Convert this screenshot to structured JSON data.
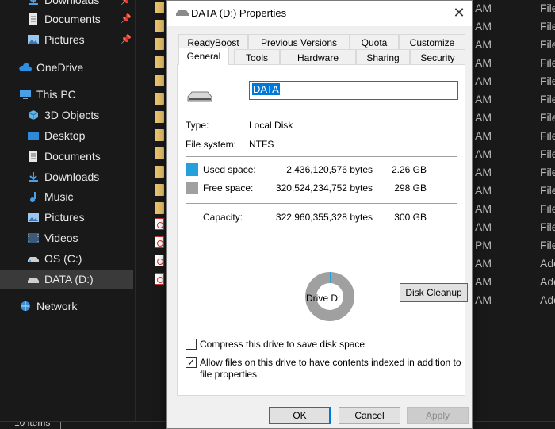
{
  "explorer": {
    "nav": [
      {
        "label": "Downloads",
        "icon": "download-arrow-icon",
        "pinned": true
      },
      {
        "label": "Documents",
        "icon": "documents-icon",
        "pinned": true
      },
      {
        "label": "Pictures",
        "icon": "pictures-icon",
        "pinned": true
      },
      {
        "label": "OneDrive",
        "icon": "cloud-icon"
      },
      {
        "label": "This PC",
        "icon": "computer-icon"
      },
      {
        "label": "3D Objects",
        "icon": "cube-icon"
      },
      {
        "label": "Desktop",
        "icon": "desktop-icon"
      },
      {
        "label": "Documents",
        "icon": "documents-icon"
      },
      {
        "label": "Downloads",
        "icon": "download-arrow-icon"
      },
      {
        "label": "Music",
        "icon": "music-note-icon"
      },
      {
        "label": "Pictures",
        "icon": "pictures-icon"
      },
      {
        "label": "Videos",
        "icon": "video-icon"
      },
      {
        "label": "OS (C:)",
        "icon": "drive-icon"
      },
      {
        "label": "DATA (D:)",
        "icon": "drive-icon",
        "selected": true
      },
      {
        "label": "Network",
        "icon": "network-icon"
      }
    ],
    "right_column": [
      "AM",
      "AM",
      "AM",
      "AM",
      "AM",
      "AM",
      "AM",
      "AM",
      "AM",
      "AM",
      "AM",
      "AM",
      "AM",
      "PM",
      "AM",
      "AM",
      "AM"
    ],
    "right_column2": [
      "File",
      "File",
      "File",
      "File",
      "File",
      "File",
      "File",
      "File",
      "File",
      "File",
      "File",
      "File",
      "File",
      "File",
      "Ado",
      "Ado",
      "Ado"
    ],
    "status": "10 items"
  },
  "dialog": {
    "title": "DATA (D:) Properties",
    "close_glyph": "✕",
    "tabs_back": [
      "ReadyBoost",
      "Previous Versions",
      "Quota",
      "Customize"
    ],
    "tabs_front": [
      "General",
      "Tools",
      "Hardware",
      "Sharing",
      "Security"
    ],
    "active_tab": "General",
    "volume_name": "DATA",
    "type_label": "Type:",
    "type_value": "Local Disk",
    "fs_label": "File system:",
    "fs_value": "NTFS",
    "used": {
      "label": "Used space:",
      "bytes": "2,436,120,576 bytes",
      "size": "2.26 GB",
      "color": "#26a0da"
    },
    "free": {
      "label": "Free space:",
      "bytes": "320,524,234,752 bytes",
      "size": "298 GB",
      "color": "#a0a0a0"
    },
    "capacity": {
      "label": "Capacity:",
      "bytes": "322,960,355,328 bytes",
      "size": "300 GB"
    },
    "used_fraction": 0.0075,
    "drive_label": "Drive D:",
    "cleanup_button": "Disk Cleanup",
    "compress_label": "Compress this drive to save disk space",
    "compress_checked": false,
    "index_label_line1": "Allow files on this drive to have contents indexed in addition to",
    "index_label_line2": "file properties",
    "index_checked": true,
    "check_glyph": "✓",
    "ok": "OK",
    "cancel": "Cancel",
    "apply": "Apply"
  }
}
